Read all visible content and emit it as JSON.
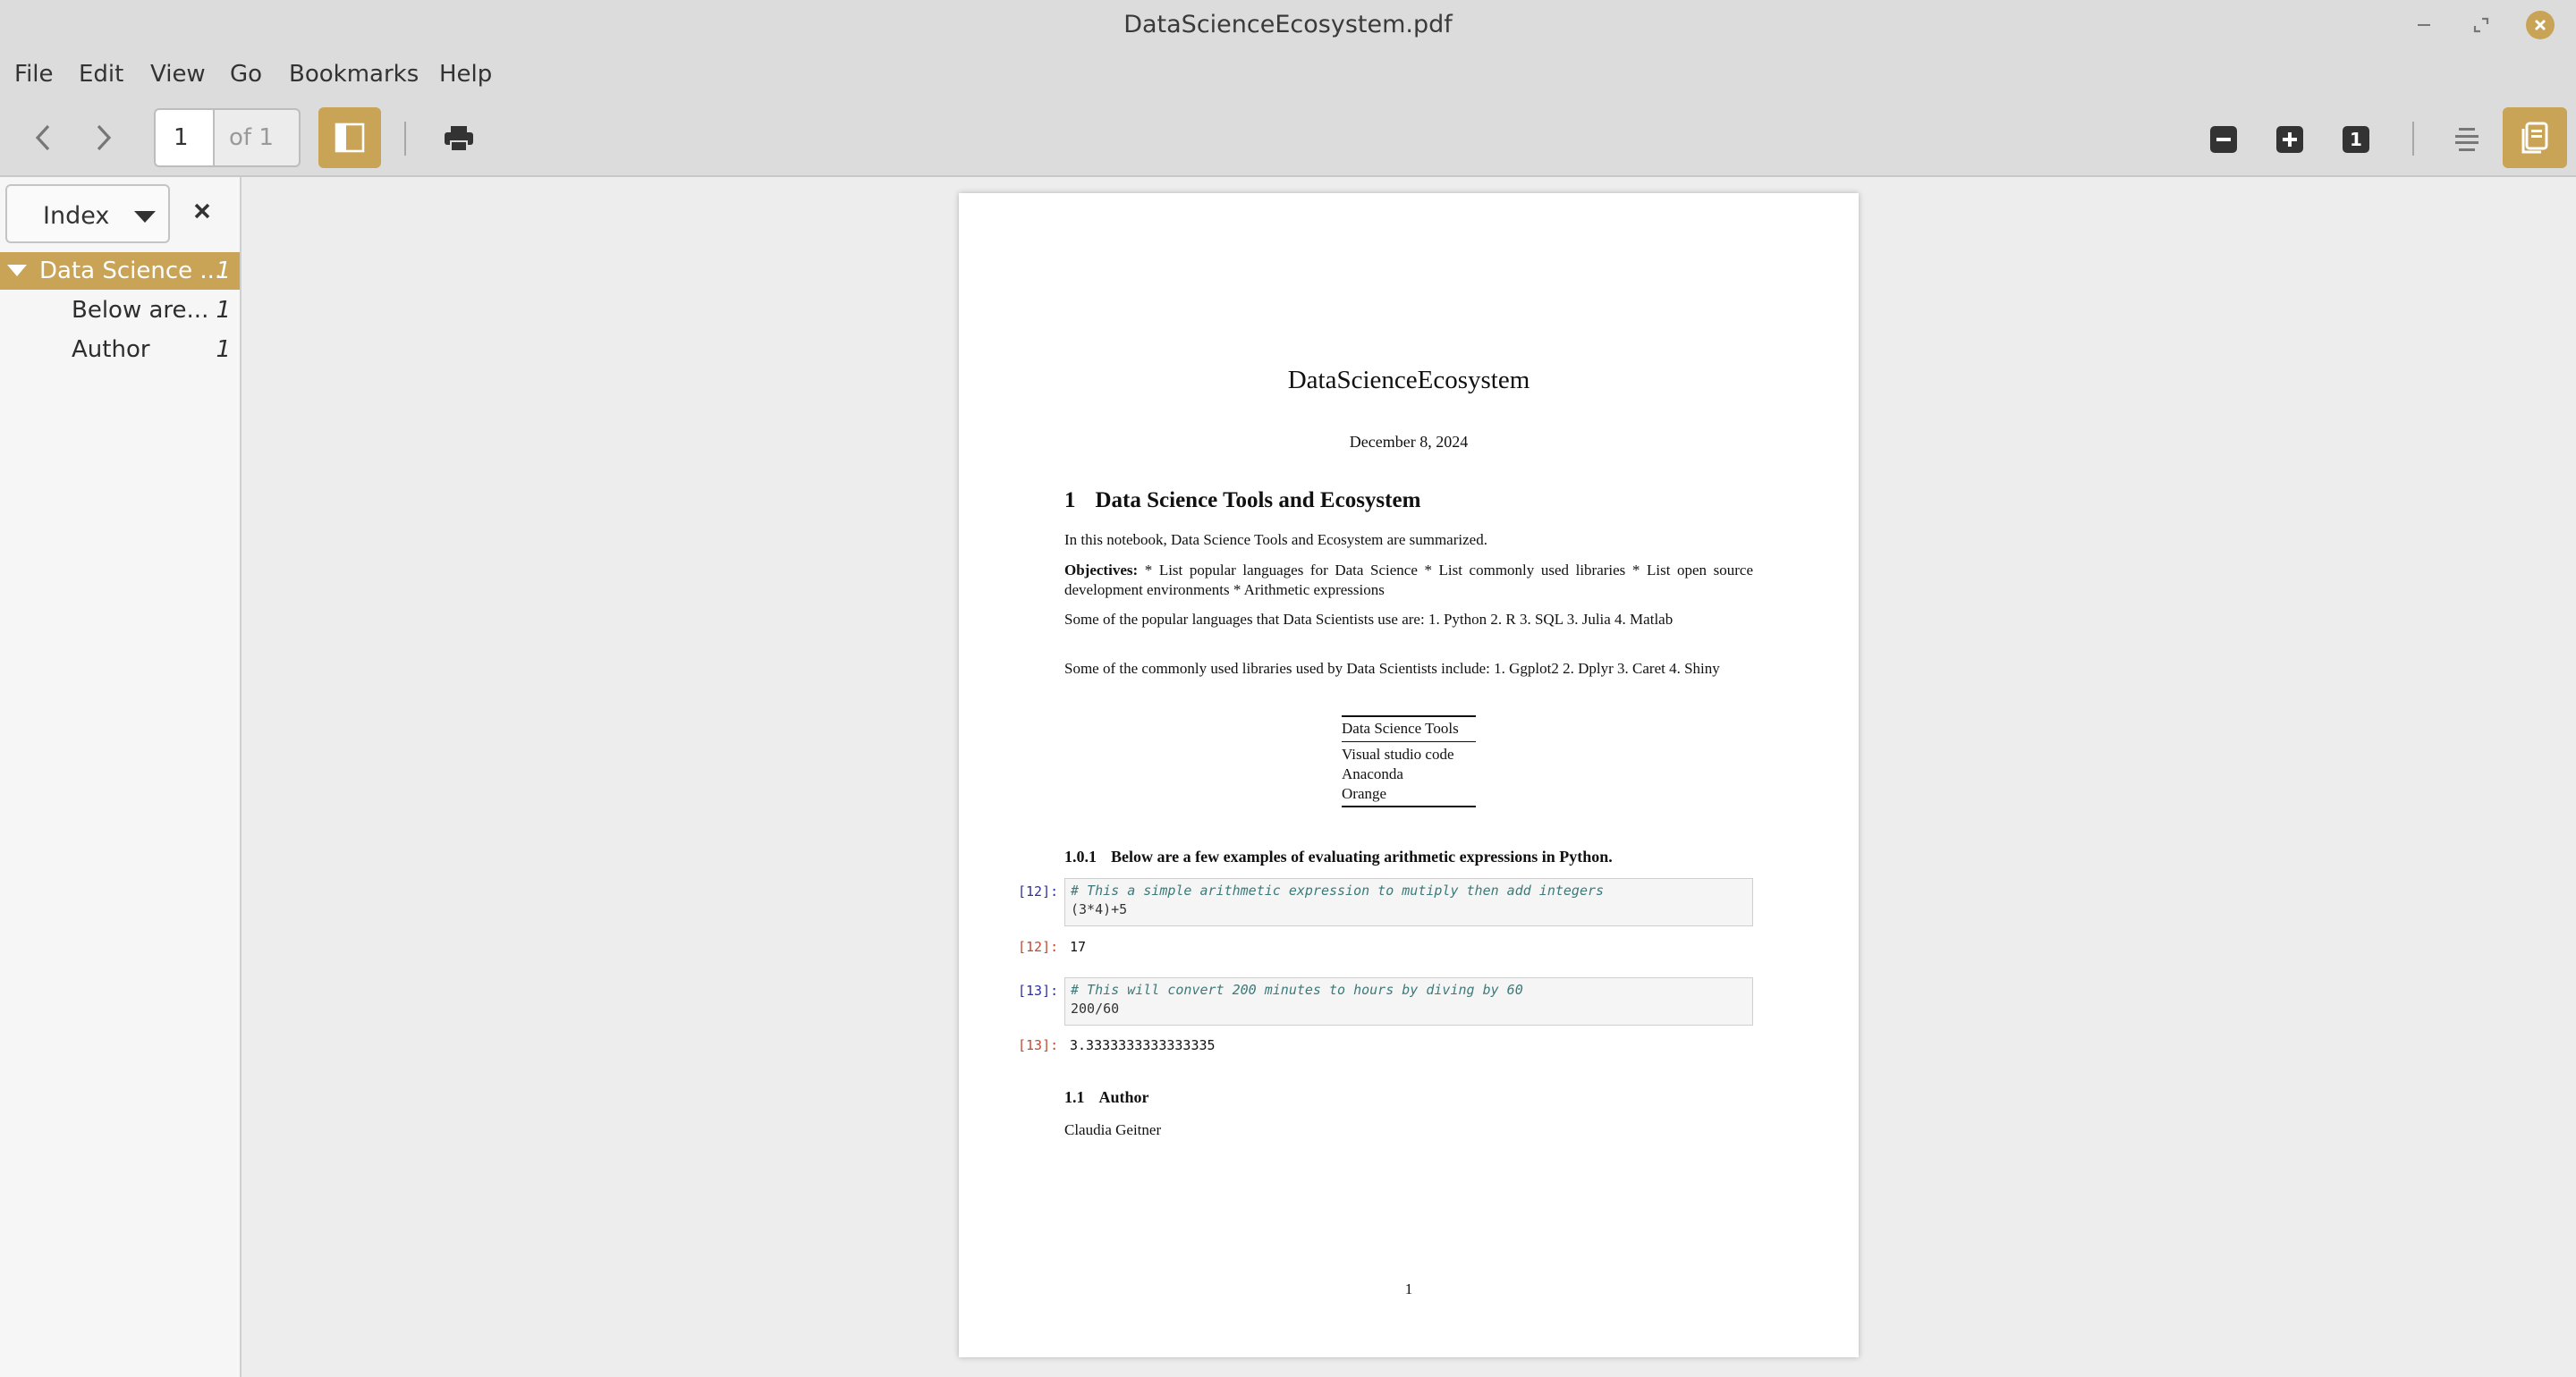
{
  "window": {
    "title": "DataScienceEcosystem.pdf"
  },
  "menu": [
    "File",
    "Edit",
    "View",
    "Go",
    "Bookmarks",
    "Help"
  ],
  "toolbar": {
    "page_current": "1",
    "page_total": "of 1",
    "zoom_reset_label": "1"
  },
  "colors": {
    "accent": "#c9a356",
    "selected_row_text": "#ffffff"
  },
  "sidebar": {
    "view_label": "Index",
    "items": [
      {
        "label": "Data Science ...",
        "page": "1"
      },
      {
        "label": "Below are...",
        "page": "1"
      },
      {
        "label": "Author",
        "page": "1"
      }
    ]
  },
  "document": {
    "title": "DataScienceEcosystem",
    "date": "December 8, 2024",
    "section": {
      "number": "1",
      "title": "Data Science Tools and Ecosystem"
    },
    "intro": "In this notebook, Data Science Tools and Ecosystem are summarized.",
    "objectives_label": "Objectives:",
    "objectives_text": "* List popular languages for Data Science * List commonly used libraries * List open source development environments * Arithmetic expressions",
    "languages": "Some of the popular languages that Data Scientists use are: 1. Python 2. R 3. SQL 3. Julia 4. Matlab",
    "libraries": "Some of the commonly used libraries used by Data Scientists include: 1. Ggplot2 2. Dplyr 3. Caret 4. Shiny",
    "table": {
      "header": "Data Science Tools",
      "rows": [
        "Visual studio code",
        "Anaconda",
        "Orange"
      ]
    },
    "subsection": {
      "number": "1.0.1",
      "title": "Below are a few examples of evaluating arithmetic expressions in Python."
    },
    "cells": [
      {
        "in_prompt": "[12]:",
        "comment": "# This a simple arithmetic expression to mutiply then add integers",
        "code": "(3*4)+5",
        "out_prompt": "[12]:",
        "output": "17"
      },
      {
        "in_prompt": "[13]:",
        "comment": "# This will convert 200 minutes to hours by diving by 60",
        "code": "200/60",
        "out_prompt": "[13]:",
        "output": "3.3333333333333335"
      }
    ],
    "author_section": {
      "number": "1.1",
      "title": "Author"
    },
    "author_name": "Claudia Geitner",
    "page_number": "1"
  }
}
